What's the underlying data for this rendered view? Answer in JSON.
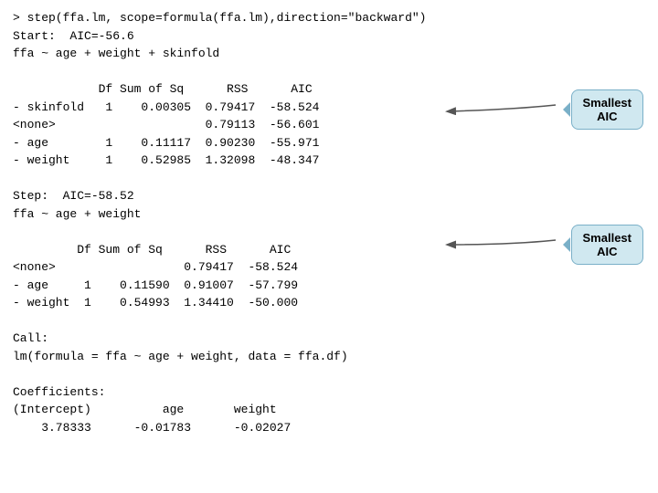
{
  "console": {
    "lines": [
      "> step(ffa.lm, scope=formula(ffa.lm),direction=\"backward\")",
      "Start:  AIC=-56.6",
      "ffa ~ age + weight + skinfold",
      "",
      "            Df Sum of Sq      RSS      AIC",
      "- skinfold   1    0.00305  0.79417  -58.524",
      "<none>                     0.79113  -56.601",
      "- age        1    0.11117  0.90230  -55.971",
      "- weight     1    0.52985  1.32098  -48.347",
      "",
      "Step:  AIC=-58.52",
      "ffa ~ age + weight",
      "",
      "         Df Sum of Sq      RSS      AIC",
      "<none>                  0.79417  -58.524",
      "- age     1    0.11590  0.91007  -57.799",
      "- weight  1    0.54993  1.34410  -50.000",
      "",
      "Call:",
      "lm(formula = ffa ~ age + weight, data = ffa.df)",
      "",
      "Coefficients:",
      "(Intercept)          age       weight",
      "    3.78333      -0.01783      -0.02027"
    ]
  },
  "tooltip1": {
    "line1": "Smallest",
    "line2": "AIC"
  },
  "tooltip2": {
    "line1": "Smallest",
    "line2": "AIC"
  }
}
